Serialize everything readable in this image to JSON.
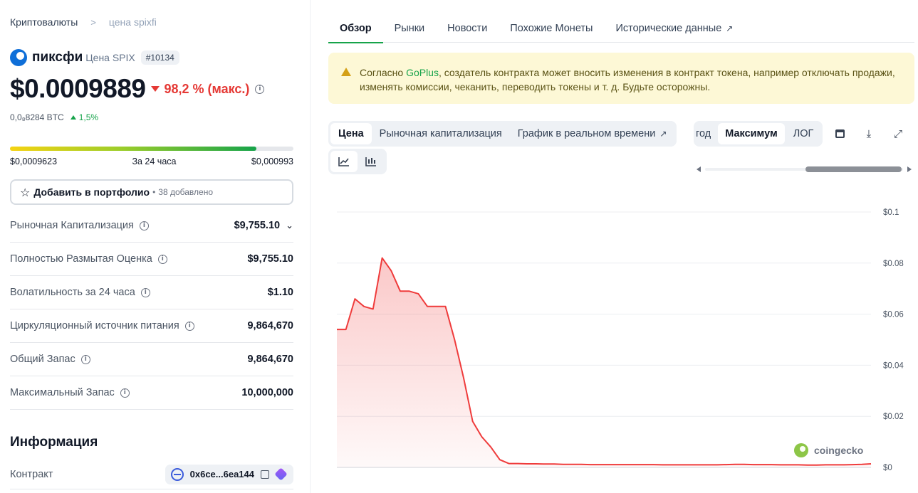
{
  "breadcrumb": {
    "parent": "Криптовалюты",
    "separator": ">",
    "current": "цена spixfi"
  },
  "coin": {
    "name": "пиксфи",
    "symbol_label": "Цена SPIX",
    "rank": "#10134",
    "price": "$0.0009889",
    "change": "98,2 % (макс.)",
    "btc_price": "0,0₈8284 BTC",
    "btc_change": "1,5%"
  },
  "range_24h": {
    "low": "$0,0009623",
    "label": "За 24 часа",
    "high": "$0,000993",
    "fill_fraction": 0.87
  },
  "portfolio": {
    "label": "Добавить в портфолио",
    "separator": "•",
    "count": "38 добавлено"
  },
  "stats": [
    {
      "label": "Рыночная Капитализация",
      "value": "$9,755.10"
    },
    {
      "label": "Полностью Размытая Оценка",
      "value": "$9,755.10"
    },
    {
      "label": "Волатильность за 24 часа",
      "value": "$1.10"
    },
    {
      "label": "Циркуляционный источник питания",
      "value": "9,864,670"
    },
    {
      "label": "Общий Запас",
      "value": "9,864,670"
    },
    {
      "label": "Максимальный Запас",
      "value": "10,000,000"
    }
  ],
  "info": {
    "heading": "Информация",
    "contract_label": "Контракт",
    "contract_value": "0x6ce...6ea144"
  },
  "tabs": [
    "Обзор",
    "Рынки",
    "Новости",
    "Похожие Монеты",
    "Исторические данные"
  ],
  "warning": {
    "prefix": "Согласно ",
    "link": "GoPlus",
    "text": ", создатель контракта может вносить изменения в контракт токена, например отключать продажи, изменять комиссии, чеканить, переводить токены и т. д. Будьте осторожны."
  },
  "chart_tabs": [
    "Цена",
    "Рыночная капитализация",
    "График в реальном времени"
  ],
  "range_tabs": [
    "год",
    "Максимум",
    "ЛОГ"
  ],
  "watermark": "coingecko",
  "colors": {
    "accent_green": "#16a34a",
    "negative_red": "#e53935",
    "line_red": "#ef3b3b",
    "warning_bg": "#fdf8d6"
  },
  "chart_data": {
    "type": "area",
    "title": "",
    "xlabel": "",
    "ylabel": "",
    "ylim": [
      0,
      0.1
    ],
    "yticks": [
      "$0",
      "$0.02",
      "$0.04",
      "$0.06",
      "$0.08",
      "$0.1"
    ],
    "grid": true,
    "series": [
      {
        "values": [
          0.054,
          0.054,
          0.066,
          0.063,
          0.062,
          0.082,
          0.077,
          0.069,
          0.069,
          0.068,
          0.063,
          0.063,
          0.063,
          0.05,
          0.035,
          0.018,
          0.012,
          0.008,
          0.003,
          0.0015,
          0.0015,
          0.0014,
          0.0014,
          0.0013,
          0.0013,
          0.0012,
          0.0012,
          0.0012,
          0.0011,
          0.0011,
          0.0011,
          0.0011,
          0.0011,
          0.0011,
          0.0011,
          0.0011,
          0.001,
          0.001,
          0.001,
          0.001,
          0.001,
          0.001,
          0.001,
          0.0011,
          0.0012,
          0.0012,
          0.0011,
          0.0011,
          0.0011,
          0.001,
          0.001,
          0.001,
          0.0009,
          0.0009,
          0.001,
          0.001,
          0.001,
          0.0011,
          0.0012,
          0.0014
        ]
      }
    ]
  }
}
